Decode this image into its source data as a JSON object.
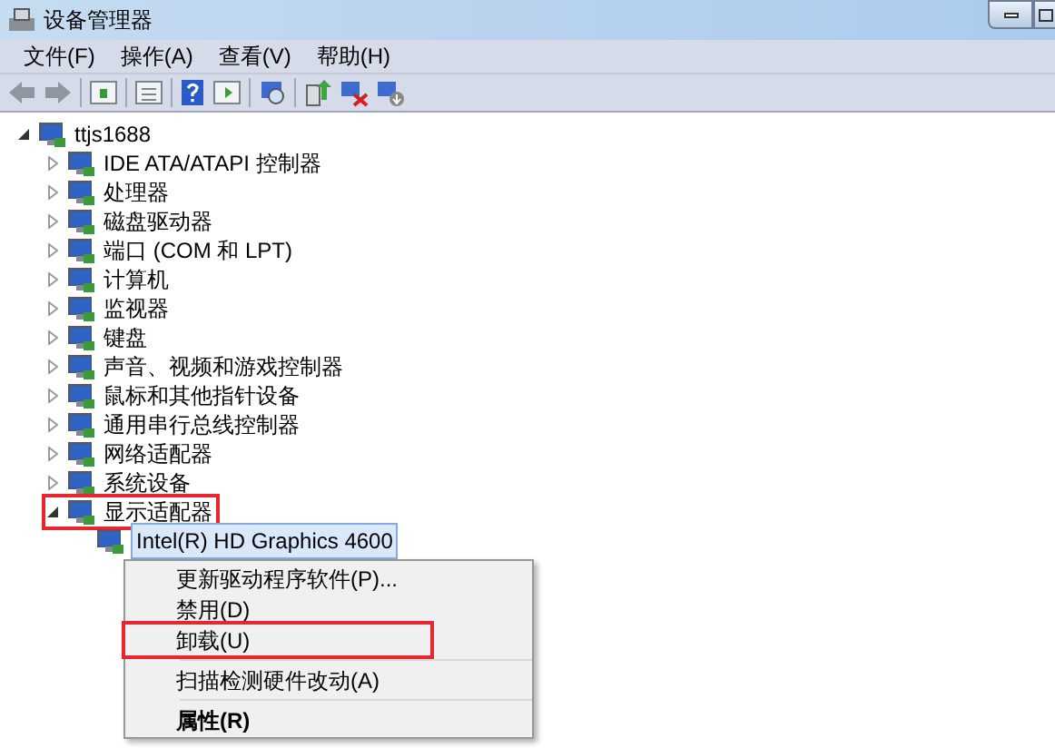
{
  "window": {
    "title": "设备管理器"
  },
  "menu_bar": [
    "文件(F)",
    "操作(A)",
    "查看(V)",
    "帮助(H)"
  ],
  "tree": {
    "label": "ttjs1688",
    "expanded": true,
    "highlighted": false,
    "children": [
      {
        "label": "IDE ATA/ATAPI 控制器",
        "expanded": false,
        "highlighted": false
      },
      {
        "label": "处理器",
        "expanded": false,
        "highlighted": false
      },
      {
        "label": "磁盘驱动器",
        "expanded": false,
        "highlighted": false
      },
      {
        "label": "端口 (COM 和 LPT)",
        "expanded": false,
        "highlighted": false
      },
      {
        "label": "计算机",
        "expanded": false,
        "highlighted": false
      },
      {
        "label": "监视器",
        "expanded": false,
        "highlighted": false
      },
      {
        "label": "键盘",
        "expanded": false,
        "highlighted": false
      },
      {
        "label": "声音、视频和游戏控制器",
        "expanded": false,
        "highlighted": false
      },
      {
        "label": "鼠标和其他指针设备",
        "expanded": false,
        "highlighted": false
      },
      {
        "label": "通用串行总线控制器",
        "expanded": false,
        "highlighted": false
      },
      {
        "label": "网络适配器",
        "expanded": false,
        "highlighted": false
      },
      {
        "label": "系统设备",
        "expanded": false,
        "highlighted": false
      },
      {
        "label": "显示适配器",
        "expanded": true,
        "highlighted": true,
        "children": [
          {
            "label": "Intel(R) HD Graphics 4600",
            "selected": true,
            "highlighted": false
          }
        ]
      }
    ]
  },
  "context_menu": {
    "groups": [
      [
        {
          "label": "更新驱动程序软件(P)...",
          "default": false,
          "highlighted": false
        },
        {
          "label": "禁用(D)",
          "default": false,
          "highlighted": false
        },
        {
          "label": "卸载(U)",
          "default": false,
          "highlighted": true
        }
      ],
      [
        {
          "label": "扫描检测硬件改动(A)",
          "default": false,
          "highlighted": false
        }
      ],
      [
        {
          "label": "属性(R)",
          "default": true,
          "highlighted": false
        }
      ]
    ]
  }
}
